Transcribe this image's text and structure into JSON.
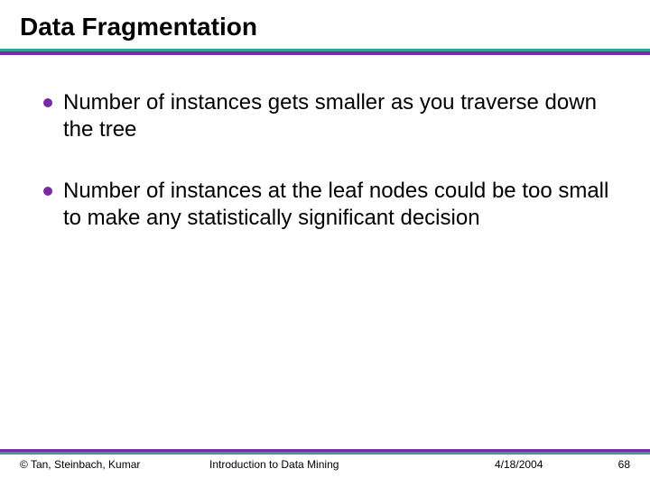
{
  "title": "Data Fragmentation",
  "bullets": [
    "Number of instances gets smaller as you traverse down the tree",
    "Number of instances at the leaf nodes could be too small to make any statistically significant decision"
  ],
  "footer": {
    "copyright": "© Tan, Steinbach, Kumar",
    "center": "Introduction to Data Mining",
    "date": "4/18/2004",
    "page": "68"
  }
}
